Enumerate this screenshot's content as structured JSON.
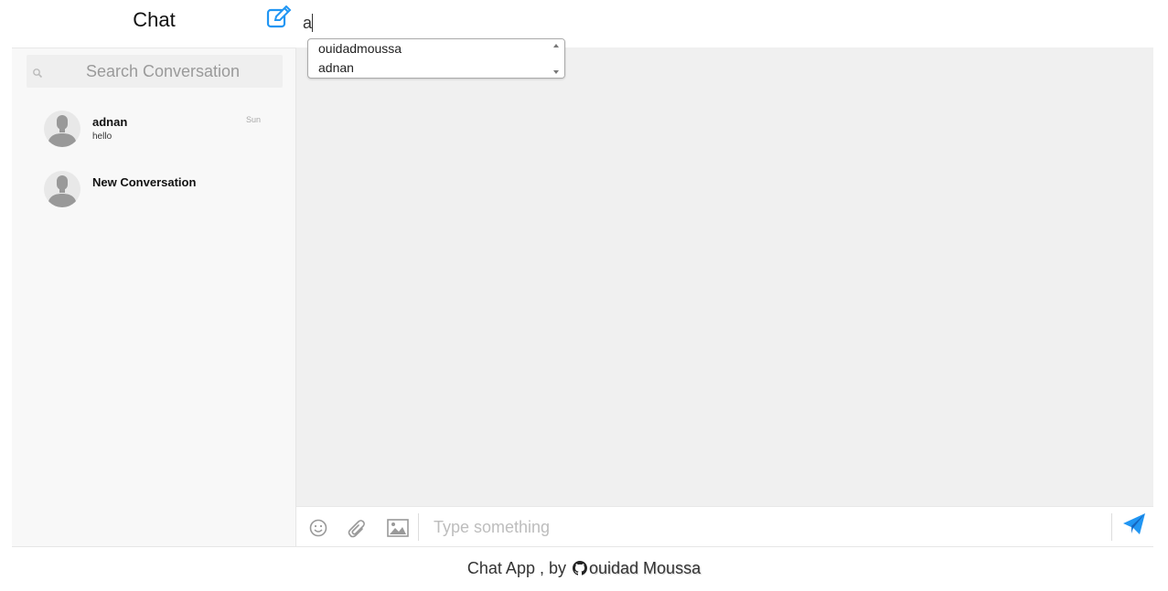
{
  "sidebar": {
    "title": "Chat",
    "compose_icon": "edit-icon",
    "search": {
      "placeholder": "Search Conversation",
      "value": ""
    },
    "conversations": [
      {
        "name": "adnan",
        "last_message": "hello",
        "time": "Sun"
      },
      {
        "name": "New Conversation",
        "last_message": "",
        "time": ""
      }
    ]
  },
  "main": {
    "recipient_input": {
      "value": "a"
    },
    "suggestions": [
      "ouidadmoussa",
      "adnan"
    ],
    "composer": {
      "placeholder": "Type something",
      "tools": [
        "smiley-icon",
        "paperclip-icon",
        "image-icon"
      ],
      "send_icon": "send-icon"
    }
  },
  "footer": {
    "prefix": "Chat App , by",
    "author": "ouidad Moussa",
    "author_icon": "github-icon"
  },
  "colors": {
    "accent": "#2196f3",
    "panel": "#f0f0f0",
    "sidebar": "#f8f8f8"
  }
}
